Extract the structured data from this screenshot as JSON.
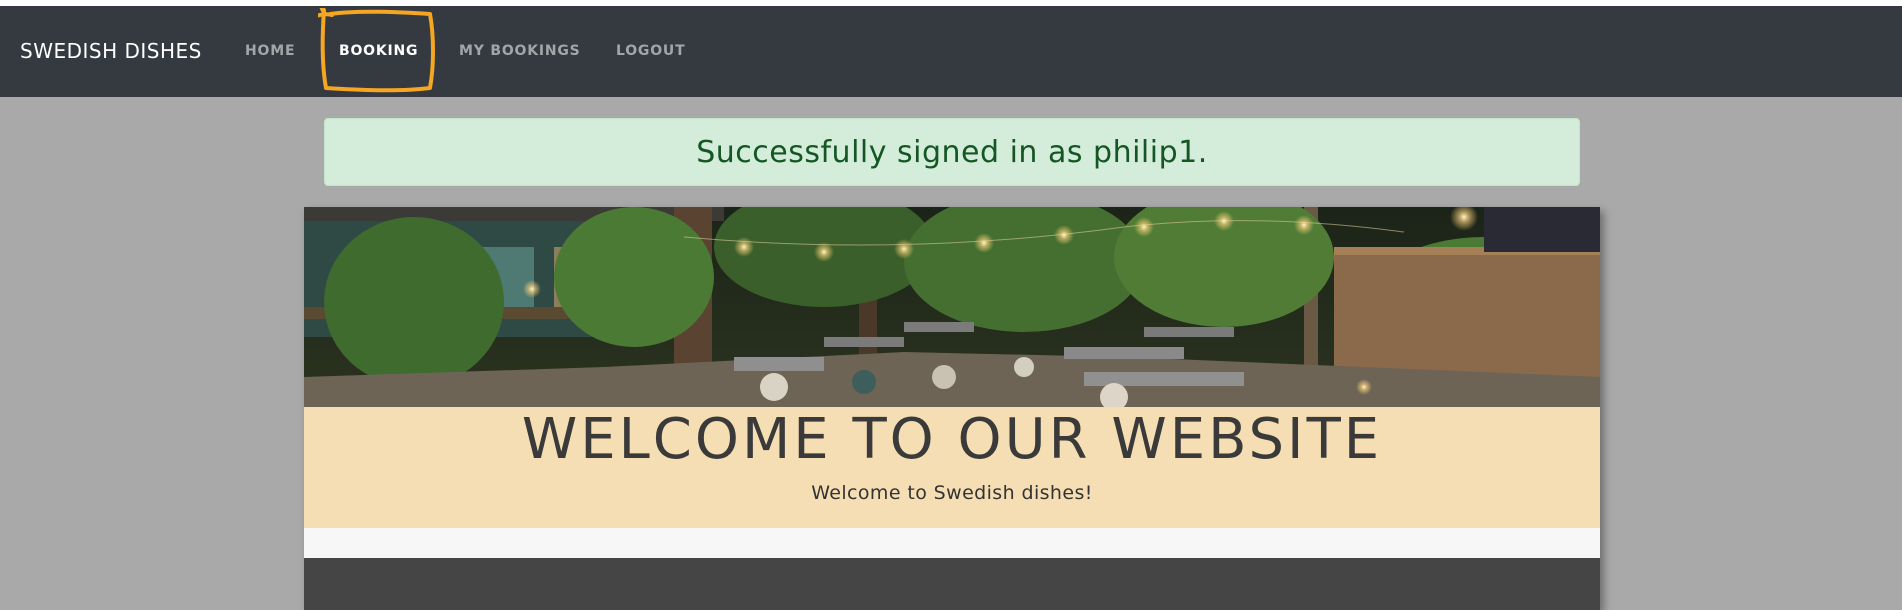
{
  "navbar": {
    "brand": "SWEDISH DISHES",
    "links": [
      {
        "label": "HOME",
        "active": false
      },
      {
        "label": "BOOKING",
        "active": true
      },
      {
        "label": "MY BOOKINGS",
        "active": false
      },
      {
        "label": "LOGOUT",
        "active": false
      }
    ],
    "background": "#343a40"
  },
  "alert": {
    "message": "Successfully signed in as philip1.",
    "background": "#d4edda",
    "text_color": "#155724"
  },
  "hero": {
    "image_description_icon": "restaurant-terrace-photo"
  },
  "welcome": {
    "title": "WELCOME TO OUR WEBSITE",
    "subtitle": "Welcome to Swedish dishes!",
    "background": "#f5deb3"
  },
  "annotation": {
    "highlight_color": "#f5a623"
  }
}
